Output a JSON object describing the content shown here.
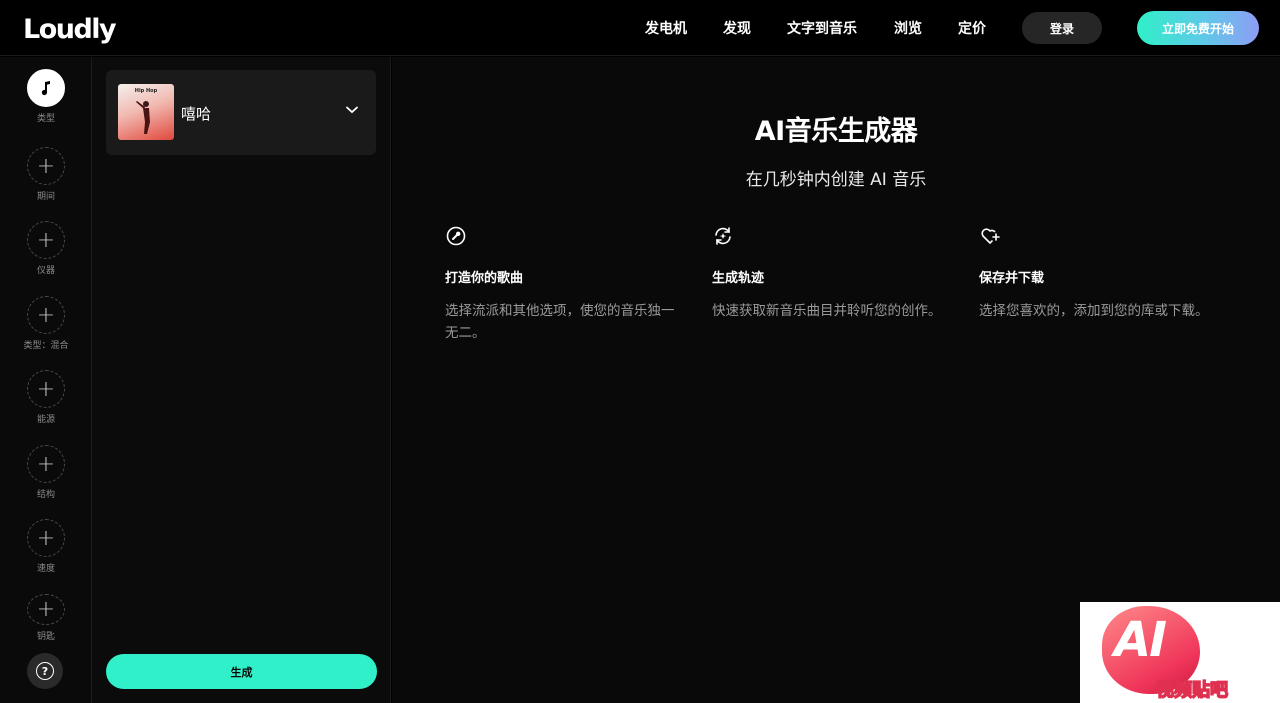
{
  "header": {
    "logo": "Loudly",
    "nav": [
      {
        "label": "发电机"
      },
      {
        "label": "发现"
      },
      {
        "label": "文字到音乐"
      },
      {
        "label": "浏览"
      },
      {
        "label": "定价"
      }
    ],
    "login_label": "登录",
    "start_label": "立即免费开始"
  },
  "rail": {
    "items": [
      {
        "label": "类型",
        "icon": "music-note-icon",
        "active": true
      },
      {
        "label": "期间",
        "icon": "plus-icon"
      },
      {
        "label": "仪器",
        "icon": "plus-icon"
      },
      {
        "label": "类型：混合",
        "icon": "plus-icon"
      },
      {
        "label": "能源",
        "icon": "plus-icon"
      },
      {
        "label": "结构",
        "icon": "plus-icon"
      },
      {
        "label": "速度",
        "icon": "plus-icon"
      },
      {
        "label": "钥匙",
        "icon": "plus-icon"
      }
    ],
    "help_icon": "question-mark-icon"
  },
  "panel": {
    "genre": {
      "thumb_label": "Hip Hop",
      "name": "嘻哈"
    },
    "generate_label": "生成"
  },
  "main": {
    "title": "AI音乐生成器",
    "subtitle": "在几秒钟内创建 AI 音乐",
    "features": [
      {
        "icon": "wrench-icon",
        "title": "打造你的歌曲",
        "desc": "选择流派和其他选项，使您的音乐独一无二。"
      },
      {
        "icon": "refresh-sparkle-icon",
        "title": "生成轨迹",
        "desc": "快速获取新音乐曲目并聆听您的创作。"
      },
      {
        "icon": "heart-plus-icon",
        "title": "保存并下载",
        "desc": "选择您喜欢的，添加到您的库或下载。"
      }
    ]
  },
  "watermark": {
    "ai": "AI",
    "text": "视频贴吧"
  },
  "colors": {
    "accent": "#2ff0c8",
    "gradient_end": "#8f9df5",
    "bg": "#000000"
  }
}
